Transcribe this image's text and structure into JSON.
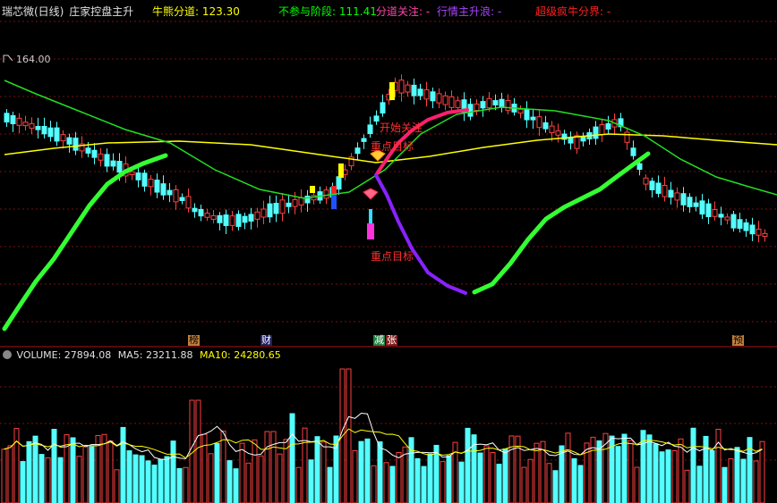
{
  "header": {
    "stock_name": "瑞芯微(日线)",
    "indicator_name": "庄家控盘主升",
    "fields": [
      {
        "label": "牛熊分道:",
        "value": "123.30",
        "color": "#ffff00"
      },
      {
        "label": "不参与阶段:",
        "value": "111.41",
        "color": "#00ff00"
      },
      {
        "label": "分道关注:",
        "value": "-",
        "color": "#ff44aa"
      },
      {
        "label": "行情主升浪:",
        "value": "-",
        "color": "#aa44ff"
      },
      {
        "label": "超级疯牛分界:",
        "value": "-",
        "color": "#ff2020"
      }
    ]
  },
  "price_panel": {
    "high_label": "164.00",
    "annotations": {
      "attention_start": "开始关注",
      "key_target_upper": "重点目标",
      "key_target_lower": "重点目标"
    }
  },
  "event_tags": [
    {
      "text": "榜",
      "bg": "#c08040",
      "color": "#000"
    },
    {
      "text": "财",
      "bg": "#202060",
      "color": "#ffffff"
    },
    {
      "text": "减",
      "bg": "#208040",
      "color": "#ffffff"
    },
    {
      "text": "张",
      "bg": "#802020",
      "color": "#ffffff"
    },
    {
      "text": "预",
      "bg": "#c08040",
      "color": "#000"
    }
  ],
  "volume_panel": {
    "label": "VOLUME:",
    "volume": "27894.08",
    "ma5_label": "MA5:",
    "ma5": "23211.88",
    "ma10_label": "MA10:",
    "ma10": "24280.65"
  },
  "colors": {
    "up": "#ff4040",
    "down": "#54ffff",
    "ma_yellow": "#ffff00",
    "ma_green": "#22dd22",
    "bull_line": "#33ff33",
    "attention_line": "#ff1f6f",
    "wave_line": "#8822ff"
  }
}
